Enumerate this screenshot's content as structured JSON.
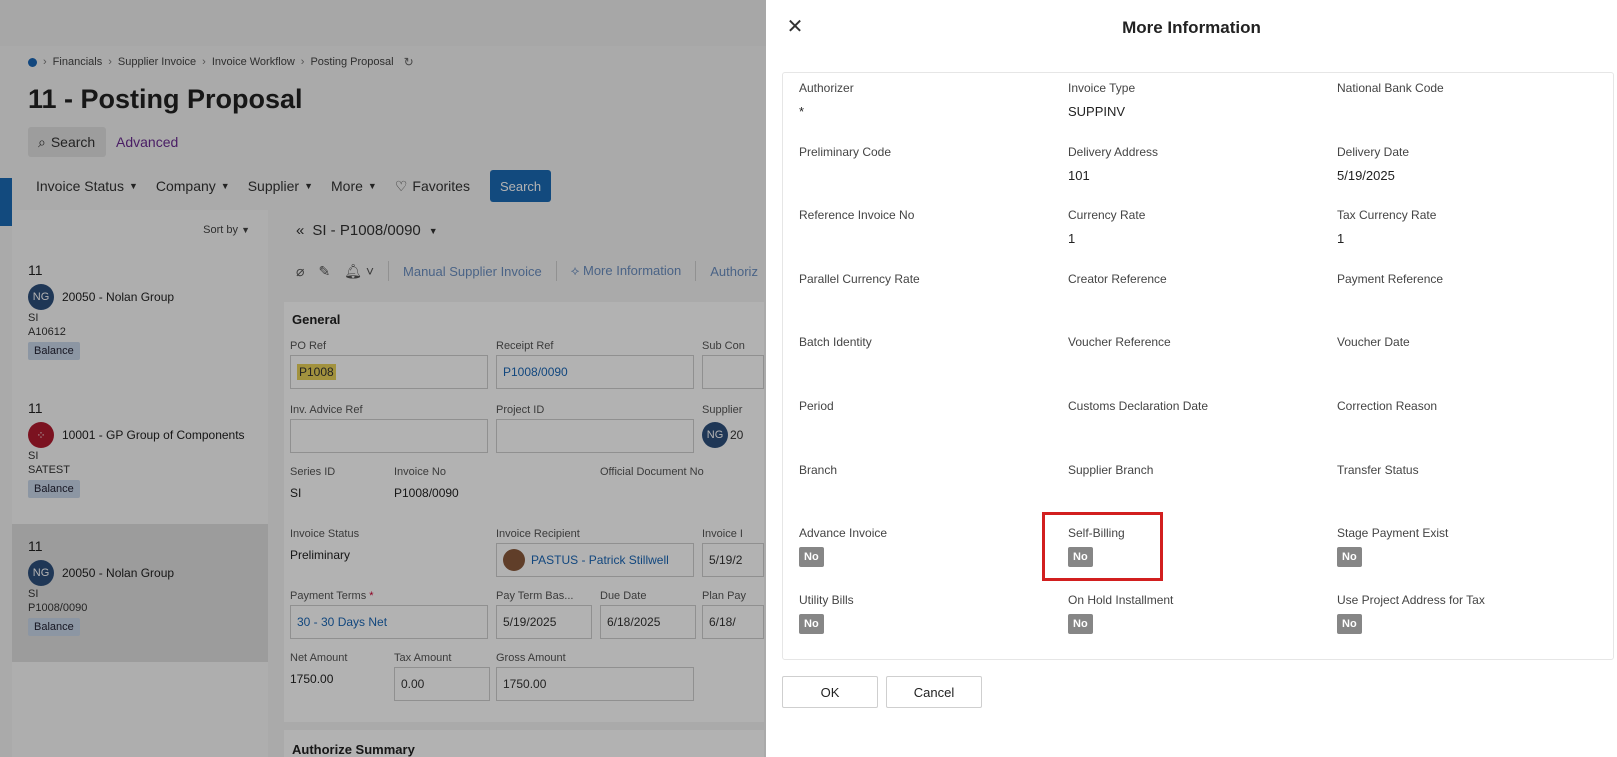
{
  "background": {
    "breadcrumb": [
      "Financials",
      "Supplier Invoice",
      "Invoice Workflow",
      "Posting Proposal"
    ],
    "page_title": "11 - Posting Proposal",
    "search_label": "Search",
    "advanced_label": "Advanced",
    "filters": [
      "Invoice Status",
      "Company",
      "Supplier",
      "More"
    ],
    "favorites_label": "Favorites",
    "search_button": "Search",
    "sort_by": "Sort by",
    "list": [
      {
        "num": "11",
        "avatar": "NG",
        "supplier": "20050 - Nolan Group",
        "series": "SI",
        "ref": "A10612",
        "badge": "Balance"
      },
      {
        "num": "11",
        "avatar": "",
        "supplier": "10001 - GP Group of Components",
        "series": "SI",
        "ref": "SATEST",
        "badge": "Balance"
      },
      {
        "num": "11",
        "avatar": "NG",
        "supplier": "20050 - Nolan Group",
        "series": "SI",
        "ref": "P1008/0090",
        "badge": "Balance"
      }
    ],
    "detail_title": "SI - P1008/0090",
    "toolbar": {
      "manual": "Manual Supplier Invoice",
      "more_info": "More Information",
      "authorize": "Authoriz"
    },
    "general": {
      "title": "General",
      "po_ref_label": "PO Ref",
      "po_ref": "P1008",
      "receipt_ref_label": "Receipt Ref",
      "receipt_ref": "P1008/0090",
      "sub_con_label": "Sub Con",
      "inv_advice_label": "Inv. Advice Ref",
      "project_id_label": "Project ID",
      "supplier_label": "Supplier",
      "supplier_avatar": "NG",
      "supplier_val": "20",
      "series_id_label": "Series ID",
      "series_id": "SI",
      "invoice_no_label": "Invoice No",
      "invoice_no": "P1008/0090",
      "official_doc_label": "Official Document No",
      "invoice_status_label": "Invoice Status",
      "invoice_status": "Preliminary",
      "recipient_label": "Invoice Recipient",
      "recipient": "PASTUS - Patrick Stillwell",
      "invoice_date_label": "Invoice I",
      "invoice_date": "5/19/2",
      "payment_terms_label": "Payment Terms",
      "payment_terms_req": "*",
      "payment_terms": "30 - 30 Days Net",
      "pay_term_base_label": "Pay Term Bas...",
      "pay_term_base": "5/19/2025",
      "due_date_label": "Due Date",
      "due_date": "6/18/2025",
      "plan_pay_label": "Plan Pay",
      "plan_pay": "6/18/",
      "net_amount_label": "Net Amount",
      "net_amount": "1750.00",
      "tax_amount_label": "Tax Amount",
      "tax_amount": "0.00",
      "gross_amount_label": "Gross Amount",
      "gross_amount": "1750.00"
    },
    "authorize_summary": "Authorize Summary"
  },
  "modal": {
    "title": "More Information",
    "fields": [
      {
        "label": "Authorizer",
        "value": "*"
      },
      {
        "label": "Invoice Type",
        "value": "SUPPINV"
      },
      {
        "label": "National Bank Code",
        "value": ""
      },
      {
        "label": "Preliminary Code",
        "value": ""
      },
      {
        "label": "Delivery Address",
        "value": "101"
      },
      {
        "label": "Delivery Date",
        "value": "5/19/2025"
      },
      {
        "label": "Reference Invoice No",
        "value": ""
      },
      {
        "label": "Currency Rate",
        "value": "1"
      },
      {
        "label": "Tax Currency Rate",
        "value": "1"
      },
      {
        "label": "Parallel Currency Rate",
        "value": ""
      },
      {
        "label": "Creator Reference",
        "value": ""
      },
      {
        "label": "Payment Reference",
        "value": ""
      },
      {
        "label": "Batch Identity",
        "value": ""
      },
      {
        "label": "Voucher Reference",
        "value": ""
      },
      {
        "label": "Voucher Date",
        "value": ""
      },
      {
        "label": "Period",
        "value": ""
      },
      {
        "label": "Customs Declaration Date",
        "value": ""
      },
      {
        "label": "Correction Reason",
        "value": ""
      },
      {
        "label": "Branch",
        "value": ""
      },
      {
        "label": "Supplier Branch",
        "value": ""
      },
      {
        "label": "Transfer Status",
        "value": ""
      }
    ],
    "toggles": [
      {
        "label": "Advance Invoice",
        "value": "No"
      },
      {
        "label": "Self-Billing",
        "value": "No"
      },
      {
        "label": "Stage Payment Exist",
        "value": "No"
      },
      {
        "label": "Utility Bills",
        "value": "No"
      },
      {
        "label": "On Hold Installment",
        "value": "No"
      },
      {
        "label": "Use Project Address for Tax",
        "value": "No"
      }
    ],
    "ok_label": "OK",
    "cancel_label": "Cancel"
  },
  "colors": {
    "accent": "#1a6ab5",
    "highlight_frame": "#d21f1f",
    "badge_gray": "#868686"
  }
}
